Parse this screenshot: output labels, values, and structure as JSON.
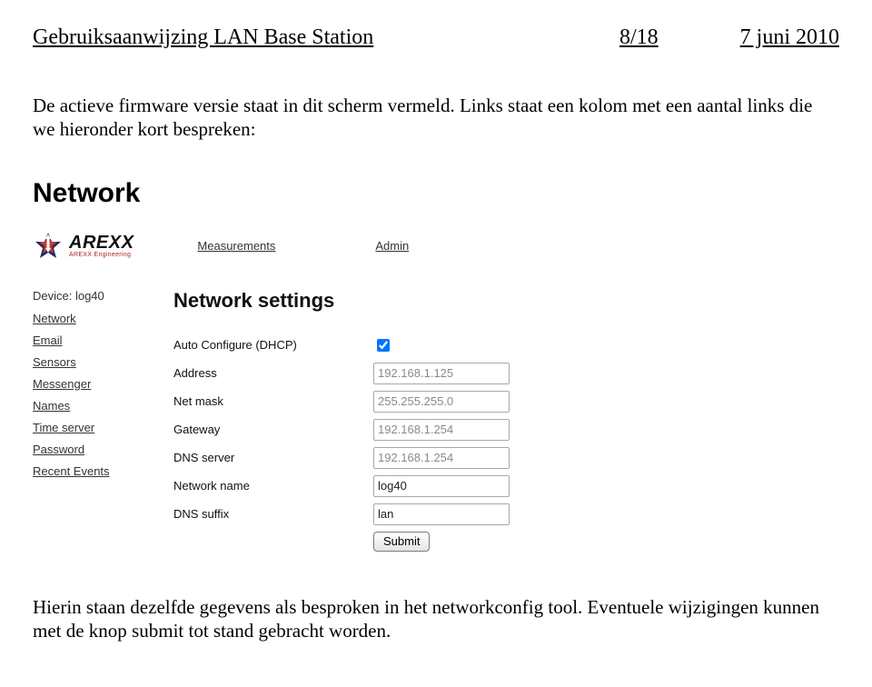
{
  "doc": {
    "title": "Gebruiksaanwijzing LAN Base Station",
    "page": "8/18",
    "date": "7 juni 2010",
    "para1": "De actieve firmware versie staat in dit scherm vermeld. Links staat een kolom met een aantal links die we hieronder kort bespreken:",
    "section_heading": "Network",
    "para2": "Hierin staan dezelfde gegevens als besproken in het networkconfig tool. Eventuele wijzigingen kunnen met de knop submit tot stand gebracht worden."
  },
  "logo": {
    "brand": "AREXX",
    "subtitle": "AREXX Engineering"
  },
  "topnav": {
    "items": [
      "Measurements",
      "Admin"
    ]
  },
  "sidebar": {
    "device_label": "Device: log40",
    "items": [
      "Network",
      "Email",
      "Sensors",
      "Messenger",
      "Names",
      "Time server",
      "Password",
      "Recent Events"
    ]
  },
  "settings": {
    "title": "Network settings",
    "dhcp_label": "Auto Configure (DHCP)",
    "address_label": "Address",
    "address_value": "192.168.1.125",
    "netmask_label": "Net mask",
    "netmask_value": "255.255.255.0",
    "gateway_label": "Gateway",
    "gateway_value": "192.168.1.254",
    "dns_label": "DNS server",
    "dns_value": "192.168.1.254",
    "name_label": "Network name",
    "name_value": "log40",
    "suffix_label": "DNS suffix",
    "suffix_value": "lan",
    "submit_label": "Submit"
  }
}
